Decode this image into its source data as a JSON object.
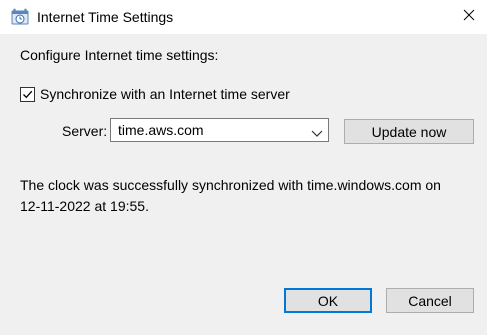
{
  "window": {
    "title": "Internet Time Settings",
    "icon": "clock-globe-icon",
    "close_icon": "close-icon"
  },
  "dialog": {
    "heading": "Configure Internet time settings:",
    "sync_checkbox": {
      "label": "Synchronize with an Internet time server",
      "checked": true
    },
    "server": {
      "label": "Server:",
      "value": "time.aws.com"
    },
    "update_button": "Update now",
    "status_line1": "The clock was successfully synchronized with time.windows.com on",
    "status_line2": "12-11-2022 at 19:55."
  },
  "buttons": {
    "ok": "OK",
    "cancel": "Cancel"
  },
  "colors": {
    "body_background": "#f0f0f0",
    "title_background": "#ffffff",
    "default_button_border": "#0078d7",
    "button_face": "#e1e1e1"
  }
}
